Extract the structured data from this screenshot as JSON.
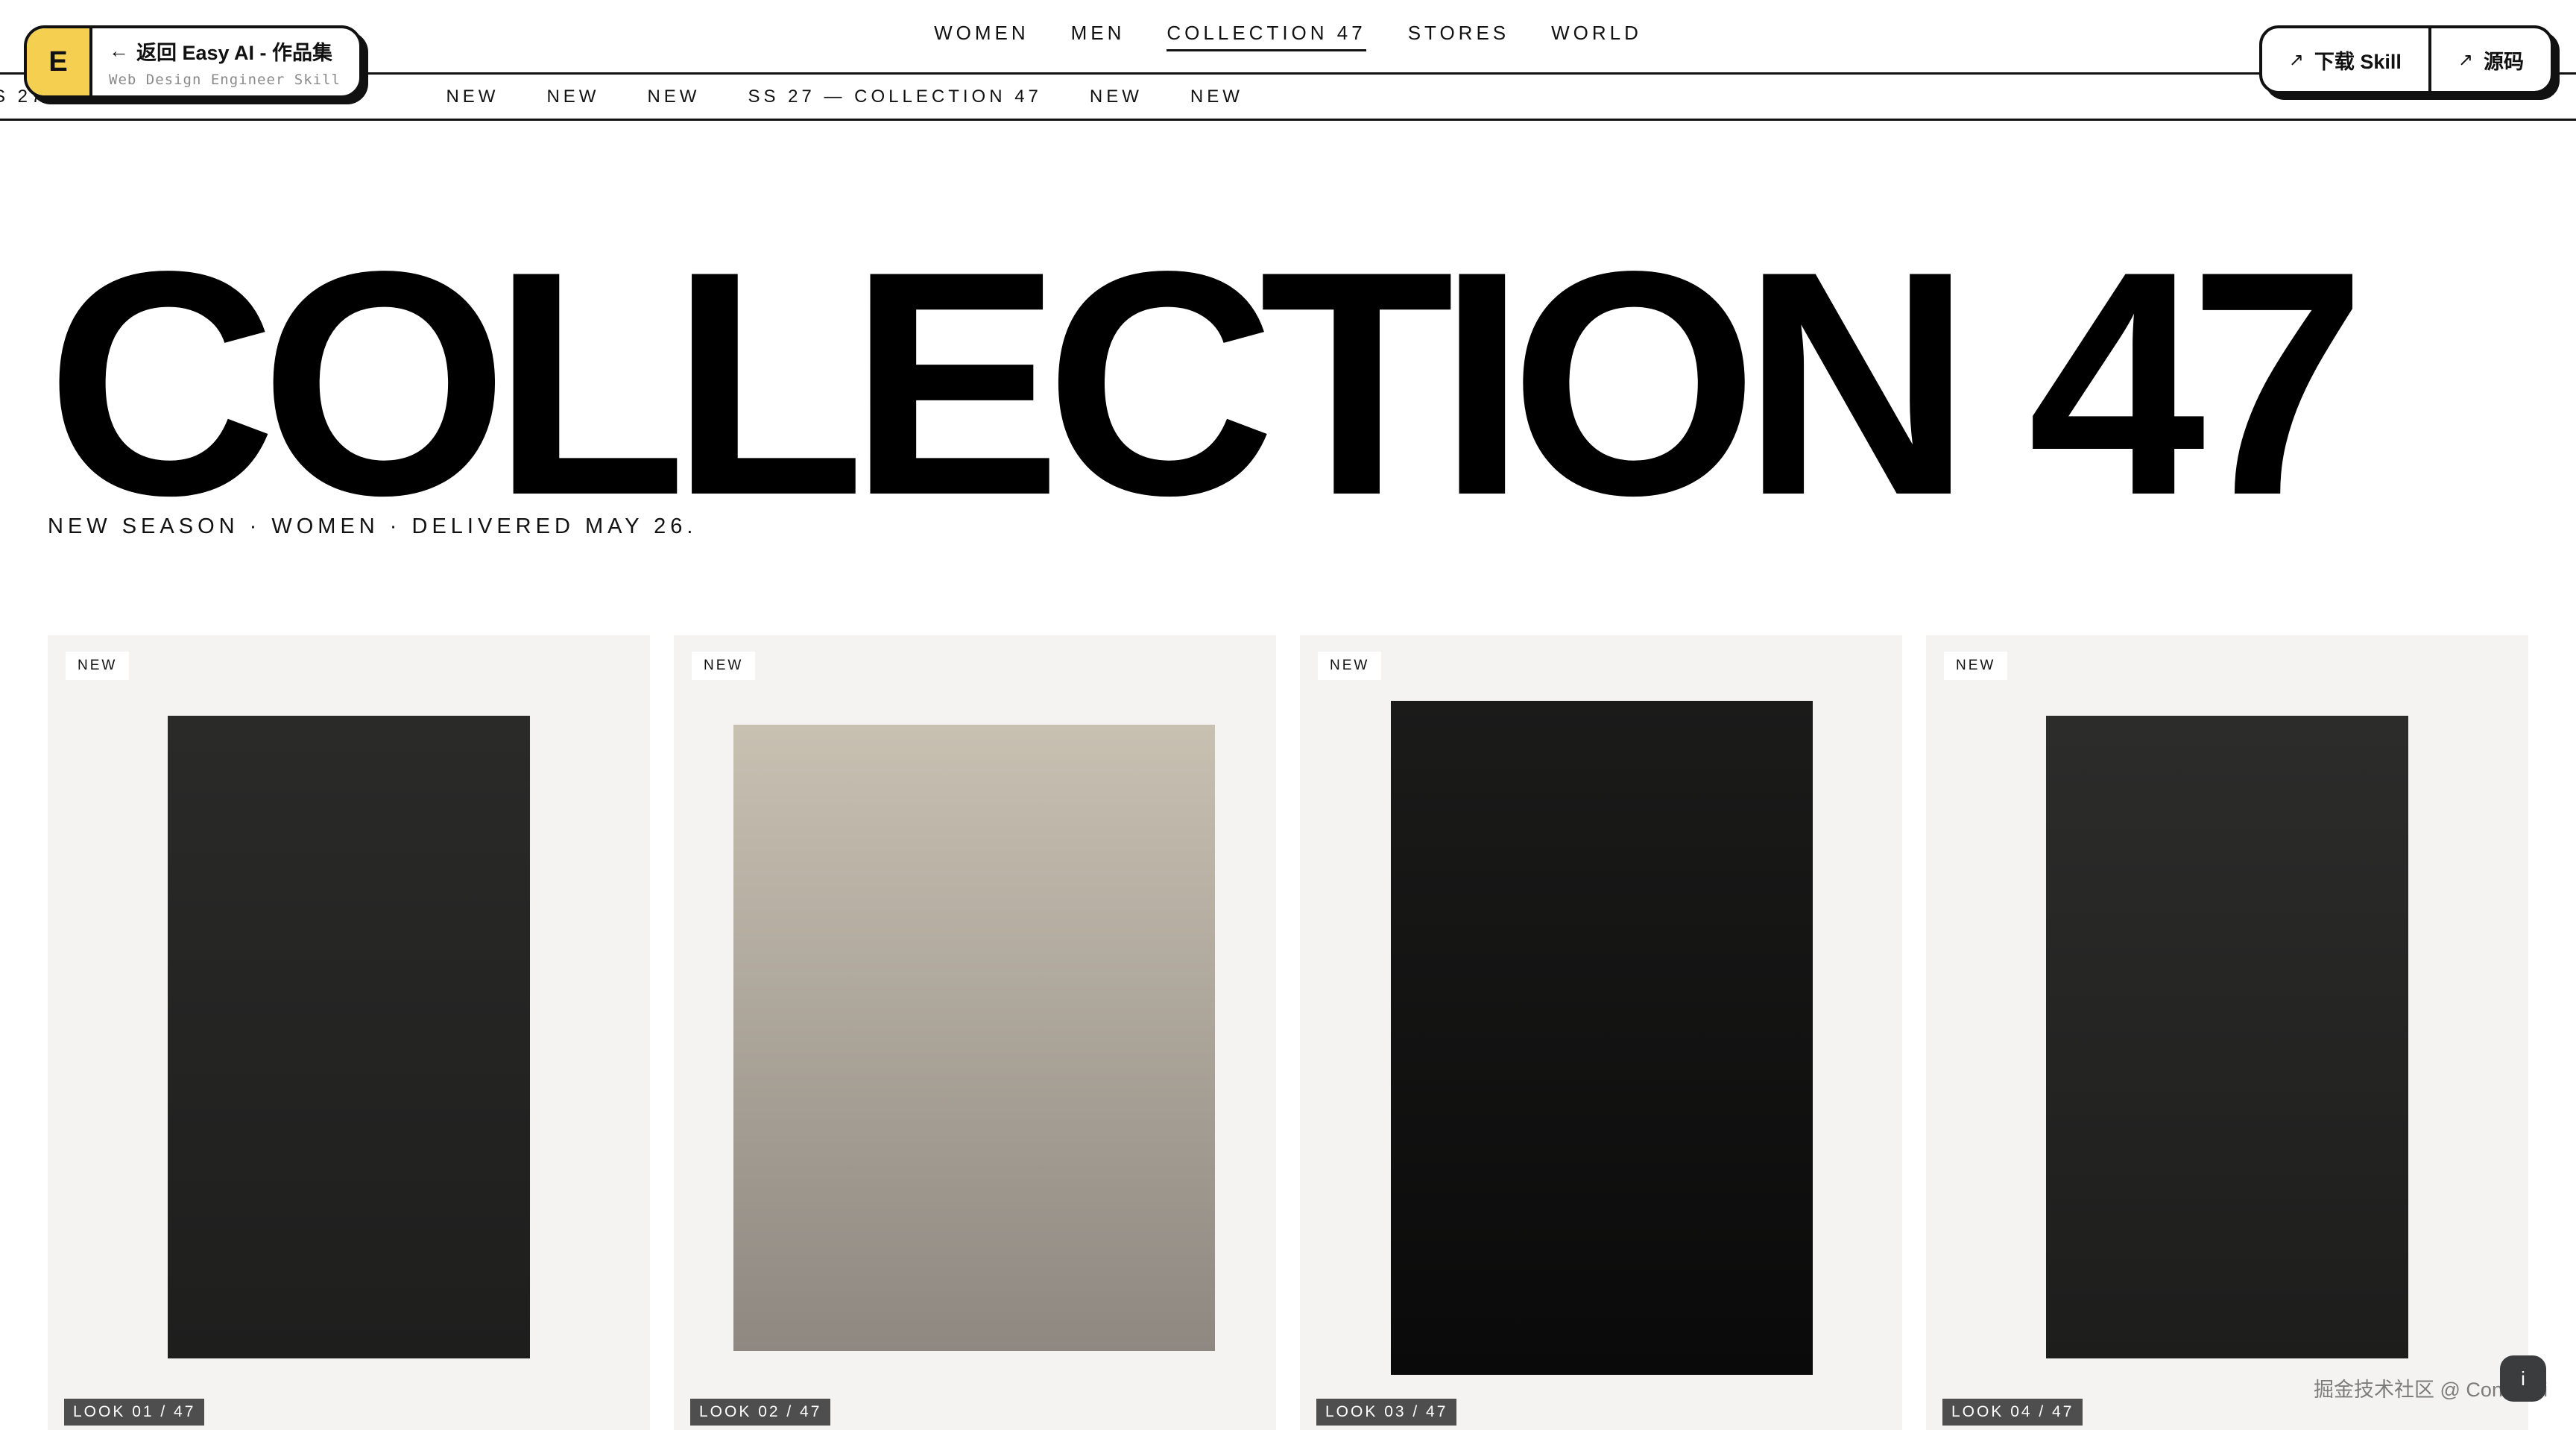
{
  "nav": {
    "links": [
      "WOMEN",
      "MEN",
      "COLLECTION 47",
      "STORES",
      "WORLD"
    ],
    "active_index": 2
  },
  "ticker": {
    "items": [
      "SS 27 — COLLECTION 47",
      "NEW",
      "NEW",
      "NEW",
      "SS 27 — COLLECTION 47",
      "NEW",
      "NEW"
    ]
  },
  "back_badge": {
    "logo_letter": "E",
    "title": "返回 Easy AI - 作品集",
    "subtitle": "Web Design Engineer Skill",
    "arrow_icon": "arrow-left-icon"
  },
  "actions": {
    "download_label": "下载 Skill",
    "source_label": "源码",
    "icon": "arrow-up-right-icon"
  },
  "hero": {
    "title": "COLLECTION 47",
    "subtitle": "NEW SEASON · WOMEN · DELIVERED MAY 26."
  },
  "products": [
    {
      "tag": "NEW",
      "look": "LOOK 01 / 47",
      "color_top": "#2a2a29",
      "color_bottom": "#1e1e1d"
    },
    {
      "tag": "NEW",
      "look": "LOOK 02 / 47",
      "color_top": "#c8c0b1",
      "color_bottom": "#8e8881"
    },
    {
      "tag": "NEW",
      "look": "LOOK 03 / 47",
      "color_top": "#1b1b1a",
      "color_bottom": "#0a0a0a"
    },
    {
      "tag": "NEW",
      "look": "LOOK 04 / 47",
      "color_top": "#2c2c2b",
      "color_bottom": "#1d1d1c"
    }
  ],
  "watermark": "掘金技术社区 @ ConardLi"
}
